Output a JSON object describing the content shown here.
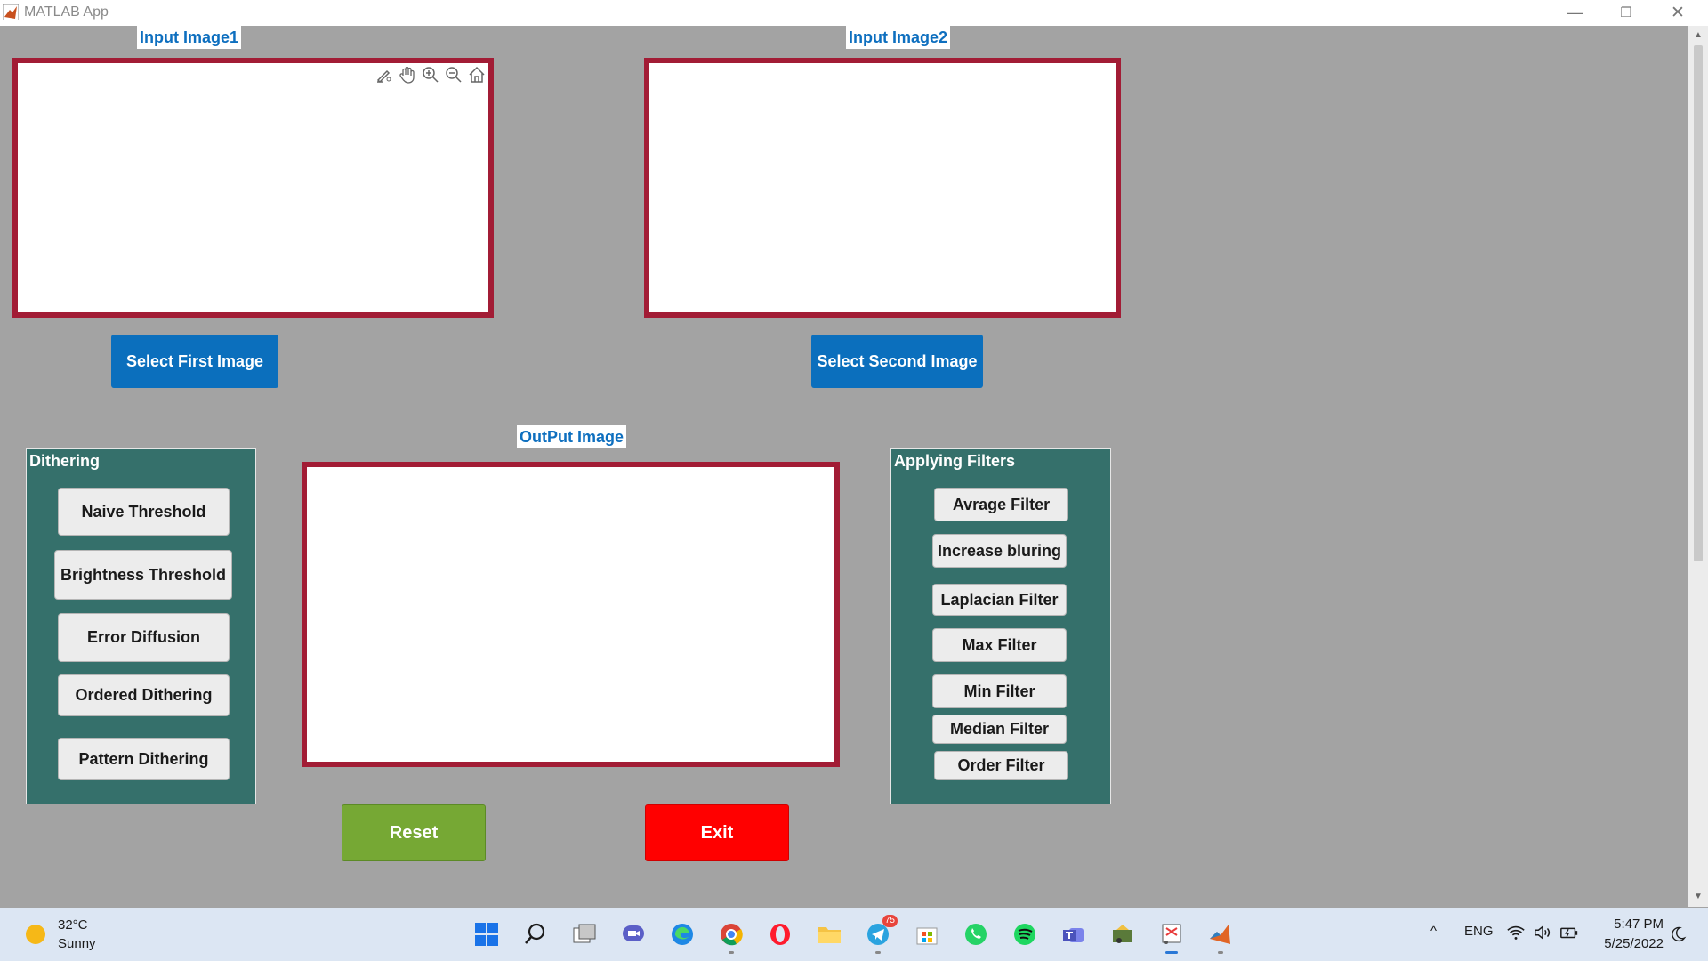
{
  "window": {
    "title": "MATLAB App",
    "minimize": "—",
    "maximize": "❐",
    "close": "✕"
  },
  "labels": {
    "input1": "Input Image1",
    "input2": "Input Image2",
    "output": "OutPut Image"
  },
  "buttons": {
    "select_first": "Select First Image",
    "select_second": "Select Second Image",
    "reset": "Reset",
    "exit": "Exit"
  },
  "dithering": {
    "title": "Dithering",
    "items": [
      "Naive Threshold",
      "Brightness Threshold",
      "Error Diffusion",
      "Ordered Dithering",
      "Pattern Dithering"
    ]
  },
  "filters": {
    "title": "Applying Filters",
    "items": [
      "Avrage Filter",
      "Increase bluring",
      "Laplacian Filter",
      "Max Filter",
      "Min Filter",
      "Median Filter",
      "Order Filter"
    ]
  },
  "axes_toolbar": [
    "brush-icon",
    "pan-hand-icon",
    "zoom-in-icon",
    "zoom-out-icon",
    "home-icon"
  ],
  "taskbar": {
    "weather_temp": "32°C",
    "weather_desc": "Sunny",
    "telegram_badge": "75",
    "language": "ENG",
    "time": "5:47 PM",
    "date": "5/25/2022",
    "chevron": "^"
  },
  "colors": {
    "background": "#a3a3a3",
    "axes_border": "#a21c35",
    "primary_button": "#0b6fbd",
    "panel": "#35706b",
    "reset": "#76a834",
    "exit": "#ff0000"
  }
}
